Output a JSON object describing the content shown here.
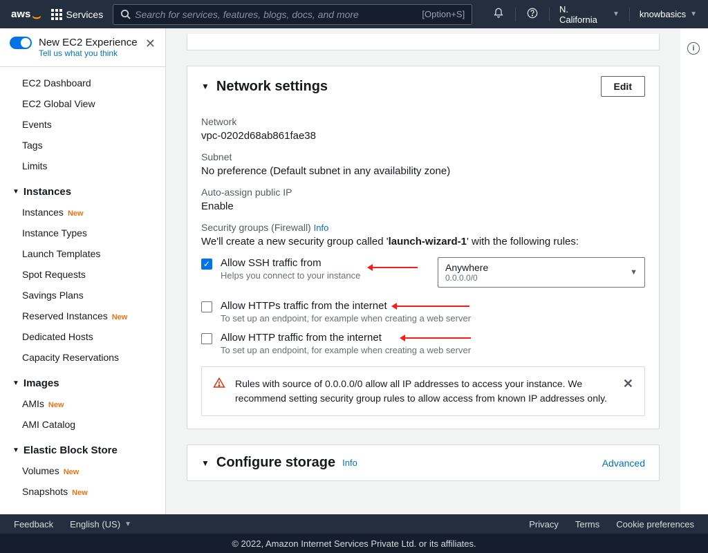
{
  "top": {
    "services": "Services",
    "search_placeholder": "Search for services, features, blogs, docs, and more",
    "shortcut": "[Option+S]",
    "region": "N. California",
    "account": "knowbasics"
  },
  "sidebar": {
    "banner_title": "New EC2 Experience",
    "banner_sub": "Tell us what you think",
    "top_items": [
      "EC2 Dashboard",
      "EC2 Global View",
      "Events",
      "Tags",
      "Limits"
    ],
    "sections": {
      "instances": {
        "label": "Instances",
        "items": [
          {
            "label": "Instances",
            "new": true
          },
          {
            "label": "Instance Types",
            "new": false
          },
          {
            "label": "Launch Templates",
            "new": false
          },
          {
            "label": "Spot Requests",
            "new": false
          },
          {
            "label": "Savings Plans",
            "new": false
          },
          {
            "label": "Reserved Instances",
            "new": true
          },
          {
            "label": "Dedicated Hosts",
            "new": false
          },
          {
            "label": "Capacity Reservations",
            "new": false
          }
        ]
      },
      "images": {
        "label": "Images",
        "items": [
          {
            "label": "AMIs",
            "new": true
          },
          {
            "label": "AMI Catalog",
            "new": false
          }
        ]
      },
      "ebs": {
        "label": "Elastic Block Store",
        "items": [
          {
            "label": "Volumes",
            "new": true
          },
          {
            "label": "Snapshots",
            "new": true
          }
        ]
      }
    },
    "new_badge": "New"
  },
  "network": {
    "title": "Network settings",
    "edit": "Edit",
    "fields": {
      "network_lbl": "Network",
      "network_val": "vpc-0202d68ab861fae38",
      "subnet_lbl": "Subnet",
      "subnet_val": "No preference (Default subnet in any availability zone)",
      "ip_lbl": "Auto-assign public IP",
      "ip_val": "Enable",
      "sg_lbl": "Security groups (Firewall)",
      "sg_info": "Info",
      "sg_desc_pre": "We'll create a new security group called '",
      "sg_name": "launch-wizard-1",
      "sg_desc_post": "' with the following rules:"
    },
    "rules": {
      "ssh": {
        "label": "Allow SSH traffic from",
        "hint": "Helps you connect to your instance",
        "checked": true,
        "select_label": "Anywhere",
        "select_sub": "0.0.0.0/0"
      },
      "https": {
        "label": "Allow HTTPs traffic from the internet",
        "hint": "To set up an endpoint, for example when creating a web server",
        "checked": false
      },
      "http": {
        "label": "Allow HTTP traffic from the internet",
        "hint": "To set up an endpoint, for example when creating a web server",
        "checked": false
      }
    },
    "alert": "Rules with source of 0.0.0.0/0 allow all IP addresses to access your instance. We recommend setting security group rules to allow access from known IP addresses only."
  },
  "storage": {
    "title": "Configure storage",
    "info": "Info",
    "advanced": "Advanced"
  },
  "footer": {
    "feedback": "Feedback",
    "lang": "English (US)",
    "privacy": "Privacy",
    "terms": "Terms",
    "cookies": "Cookie preferences",
    "copyright": "© 2022, Amazon Internet Services Private Ltd. or its affiliates."
  }
}
